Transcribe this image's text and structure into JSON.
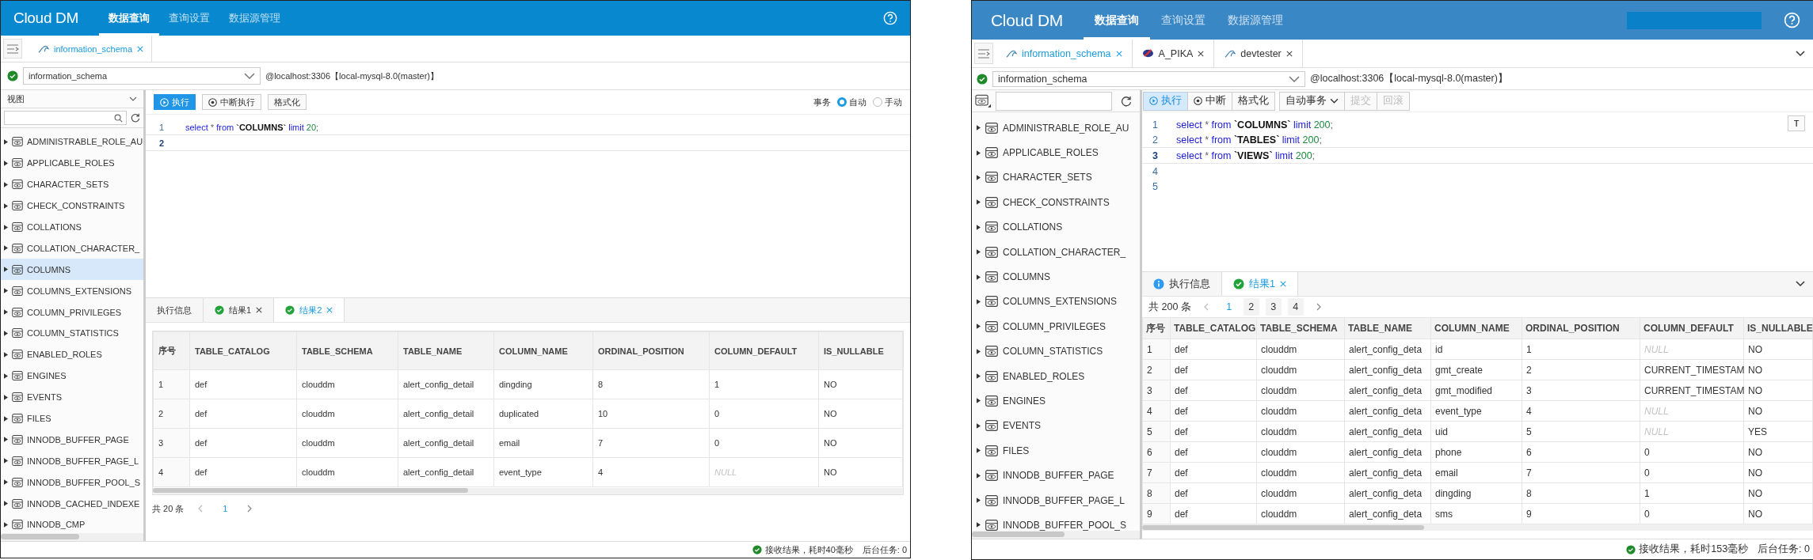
{
  "screens": [
    {
      "brand": "Cloud DM",
      "nav": [
        {
          "label": "数据查询",
          "selected": true
        },
        {
          "label": "查询设置",
          "selected": false
        },
        {
          "label": "数据源管理",
          "selected": false
        }
      ],
      "header_box": false,
      "tabs_menu": false,
      "editor_tabs": [
        {
          "label": "information_schema",
          "kind": "mysql",
          "selected": true
        }
      ],
      "connection": {
        "database": "information_schema",
        "host": "@localhost:3306【local-mysql-8.0(master)】"
      },
      "sidebar": {
        "view_select": "视图",
        "items": [
          {
            "label": "ADMINISTRABLE_ROLE_AU",
            "selected": false
          },
          {
            "label": "APPLICABLE_ROLES",
            "selected": false
          },
          {
            "label": "CHARACTER_SETS",
            "selected": false
          },
          {
            "label": "CHECK_CONSTRAINTS",
            "selected": false
          },
          {
            "label": "COLLATIONS",
            "selected": false
          },
          {
            "label": "COLLATION_CHARACTER_",
            "selected": false
          },
          {
            "label": "COLUMNS",
            "selected": true
          },
          {
            "label": "COLUMNS_EXTENSIONS",
            "selected": false
          },
          {
            "label": "COLUMN_PRIVILEGES",
            "selected": false
          },
          {
            "label": "COLUMN_STATISTICS",
            "selected": false
          },
          {
            "label": "ENABLED_ROLES",
            "selected": false
          },
          {
            "label": "ENGINES",
            "selected": false
          },
          {
            "label": "EVENTS",
            "selected": false
          },
          {
            "label": "FILES",
            "selected": false
          },
          {
            "label": "INNODB_BUFFER_PAGE",
            "selected": false
          },
          {
            "label": "INNODB_BUFFER_PAGE_L",
            "selected": false
          },
          {
            "label": "INNODB_BUFFER_POOL_S",
            "selected": false
          },
          {
            "label": "INNODB_CACHED_INDEXE",
            "selected": false
          },
          {
            "label": "INNODB_CMP",
            "selected": false
          }
        ]
      },
      "toolbar": {
        "buttons": [
          {
            "label": "执行",
            "kind": "run",
            "disabled": false
          },
          {
            "label": "中断执行",
            "kind": "stop",
            "disabled": false
          },
          {
            "label": "格式化",
            "kind": "plain",
            "disabled": false
          }
        ],
        "transaction": {
          "label": "事务",
          "options": [
            {
              "label": "自动",
              "selected": true
            },
            {
              "label": "手动",
              "selected": false
            }
          ]
        }
      },
      "editor": {
        "lines": [
          {
            "no": "1",
            "current": false,
            "tokens": [
              {
                "t": "select",
                "kind": "kw"
              },
              {
                "t": " * ",
                "kind": "op"
              },
              {
                "t": "from",
                "kind": "kw"
              },
              {
                "t": " `COLUMNS` ",
                "kind": "id"
              },
              {
                "t": "limit",
                "kind": "kw"
              },
              {
                "t": " 20",
                "kind": "num"
              },
              {
                "t": ";",
                "kind": "op"
              }
            ]
          },
          {
            "no": "2",
            "current": true
          }
        ]
      },
      "results": {
        "collapse": false,
        "tabs": [
          {
            "label": "执行信息",
            "kind": "plain",
            "closable": false,
            "selected": false
          },
          {
            "label": "结果1",
            "kind": "success",
            "closable": true,
            "selected": false
          },
          {
            "label": "结果2",
            "kind": "success",
            "closable": true,
            "selected": true
          }
        ],
        "pager": {
          "total": "共 20 条",
          "pages": [
            {
              "label": "1",
              "selected": true
            }
          ]
        },
        "table": {
          "columns": [
            "序号",
            "TABLE_CATALOG",
            "TABLE_SCHEMA",
            "TABLE_NAME",
            "COLUMN_NAME",
            "ORDINAL_POSITION",
            "COLUMN_DEFAULT",
            "IS_NULLABLE"
          ],
          "rows": [
            [
              "1",
              "def",
              "clouddm",
              "alert_config_detail",
              "dingding",
              "8",
              "1",
              "NO"
            ],
            [
              "2",
              "def",
              "clouddm",
              "alert_config_detail",
              "duplicated",
              "10",
              "0",
              "NO"
            ],
            [
              "3",
              "def",
              "clouddm",
              "alert_config_detail",
              "email",
              "7",
              "0",
              "NO"
            ],
            [
              "4",
              "def",
              "clouddm",
              "alert_config_detail",
              "event_type",
              "4",
              {
                "text": "NULL",
                "null": true
              },
              "NO"
            ]
          ]
        }
      },
      "status": {
        "message": "接收结果，耗时40毫秒",
        "tasks": "后台任务: 0"
      }
    },
    {
      "brand": "Cloud DM",
      "nav": [
        {
          "label": "数据查询",
          "selected": true
        },
        {
          "label": "查询设置",
          "selected": false
        },
        {
          "label": "数据源管理",
          "selected": false
        }
      ],
      "header_box": true,
      "tabs_menu": true,
      "editor_tabs": [
        {
          "label": "information_schema",
          "kind": "mysql",
          "selected": true
        },
        {
          "label": "A_PIKA",
          "kind": "pika",
          "selected": false
        },
        {
          "label": "devtester",
          "kind": "mysql",
          "selected": false
        }
      ],
      "connection": {
        "database": "information_schema",
        "host": "@localhost:3306【local-mysql-8.0(master)】"
      },
      "sidebar": {
        "items": [
          {
            "label": "ADMINISTRABLE_ROLE_AU",
            "selected": false
          },
          {
            "label": "APPLICABLE_ROLES",
            "selected": false
          },
          {
            "label": "CHARACTER_SETS",
            "selected": false
          },
          {
            "label": "CHECK_CONSTRAINTS",
            "selected": false
          },
          {
            "label": "COLLATIONS",
            "selected": false
          },
          {
            "label": "COLLATION_CHARACTER_",
            "selected": false
          },
          {
            "label": "COLUMNS",
            "selected": false
          },
          {
            "label": "COLUMNS_EXTENSIONS",
            "selected": false
          },
          {
            "label": "COLUMN_PRIVILEGES",
            "selected": false
          },
          {
            "label": "COLUMN_STATISTICS",
            "selected": false
          },
          {
            "label": "ENABLED_ROLES",
            "selected": false
          },
          {
            "label": "ENGINES",
            "selected": false
          },
          {
            "label": "EVENTS",
            "selected": false
          },
          {
            "label": "FILES",
            "selected": false
          },
          {
            "label": "INNODB_BUFFER_PAGE",
            "selected": false
          },
          {
            "label": "INNODB_BUFFER_PAGE_L",
            "selected": false
          },
          {
            "label": "INNODB_BUFFER_POOL_S",
            "selected": false
          }
        ]
      },
      "toolbar": {
        "buttons": [
          {
            "label": "执行",
            "kind": "run",
            "disabled": false
          },
          {
            "label": "中断",
            "kind": "stop",
            "disabled": false
          },
          {
            "label": "格式化",
            "kind": "plain",
            "disabled": false
          },
          {
            "label": "自动事务",
            "kind": "dropdown",
            "disabled": false
          },
          {
            "label": "提交",
            "kind": "plain",
            "disabled": true
          },
          {
            "label": "回滚",
            "kind": "plain",
            "disabled": true
          }
        ]
      },
      "editor": {
        "side_button": "T",
        "lines": [
          {
            "no": "1",
            "current": false,
            "tokens": [
              {
                "t": "select",
                "kind": "kw"
              },
              {
                "t": " * ",
                "kind": "op"
              },
              {
                "t": "from",
                "kind": "kw"
              },
              {
                "t": " `COLUMNS` ",
                "kind": "id"
              },
              {
                "t": "limit",
                "kind": "kw"
              },
              {
                "t": " 200",
                "kind": "num"
              },
              {
                "t": ";",
                "kind": "op"
              }
            ]
          },
          {
            "no": "2",
            "current": false,
            "tokens": [
              {
                "t": "select",
                "kind": "kw"
              },
              {
                "t": " * ",
                "kind": "op"
              },
              {
                "t": "from",
                "kind": "kw"
              },
              {
                "t": " `TABLES` ",
                "kind": "id"
              },
              {
                "t": "limit",
                "kind": "kw"
              },
              {
                "t": " 200",
                "kind": "num"
              },
              {
                "t": ";",
                "kind": "op"
              }
            ]
          },
          {
            "no": "3",
            "current": true,
            "tokens": [
              {
                "t": "select",
                "kind": "kw"
              },
              {
                "t": " * ",
                "kind": "op"
              },
              {
                "t": "from",
                "kind": "kw"
              },
              {
                "t": " `VIEWS` ",
                "kind": "id"
              },
              {
                "t": "limit",
                "kind": "kw"
              },
              {
                "t": " 200",
                "kind": "num"
              },
              {
                "t": ";",
                "kind": "op"
              }
            ]
          },
          {
            "no": "4",
            "current": false
          },
          {
            "no": "5",
            "current": false
          }
        ]
      },
      "results": {
        "collapse": true,
        "tabs": [
          {
            "label": "执行信息",
            "kind": "info",
            "closable": false,
            "selected": false
          },
          {
            "label": "结果1",
            "kind": "success",
            "closable": true,
            "selected": true
          }
        ],
        "pager": {
          "total": "共 200 条",
          "pages": [
            {
              "label": "1",
              "selected": true
            },
            {
              "label": "2",
              "selected": false
            },
            {
              "label": "3",
              "selected": false
            },
            {
              "label": "4",
              "selected": false
            }
          ]
        },
        "table": {
          "columns": [
            "序号",
            "TABLE_CATALOG",
            "TABLE_SCHEMA",
            "TABLE_NAME",
            "COLUMN_NAME",
            "ORDINAL_POSITION",
            "COLUMN_DEFAULT",
            "IS_NULLABLE"
          ],
          "rows": [
            [
              "1",
              "def",
              "clouddm",
              "alert_config_deta",
              "id",
              "1",
              {
                "text": "NULL",
                "null": true
              },
              "NO"
            ],
            [
              "2",
              "def",
              "clouddm",
              "alert_config_deta",
              "gmt_create",
              "2",
              "CURRENT_TIMESTAM",
              "NO"
            ],
            [
              "3",
              "def",
              "clouddm",
              "alert_config_deta",
              "gmt_modified",
              "3",
              "CURRENT_TIMESTAM",
              "NO"
            ],
            [
              "4",
              "def",
              "clouddm",
              "alert_config_deta",
              "event_type",
              "4",
              {
                "text": "NULL",
                "null": true
              },
              "NO"
            ],
            [
              "5",
              "def",
              "clouddm",
              "alert_config_deta",
              "uid",
              "5",
              {
                "text": "NULL",
                "null": true
              },
              "YES"
            ],
            [
              "6",
              "def",
              "clouddm",
              "alert_config_deta",
              "phone",
              "6",
              "0",
              "NO"
            ],
            [
              "7",
              "def",
              "clouddm",
              "alert_config_deta",
              "email",
              "7",
              "0",
              "NO"
            ],
            [
              "8",
              "def",
              "clouddm",
              "alert_config_deta",
              "dingding",
              "8",
              "1",
              "NO"
            ],
            [
              "9",
              "def",
              "clouddm",
              "alert_config_deta",
              "sms",
              "9",
              "0",
              "NO"
            ]
          ]
        }
      },
      "status": {
        "message": "接收结果，耗时153毫秒",
        "tasks": "后台任务: 0"
      }
    }
  ]
}
